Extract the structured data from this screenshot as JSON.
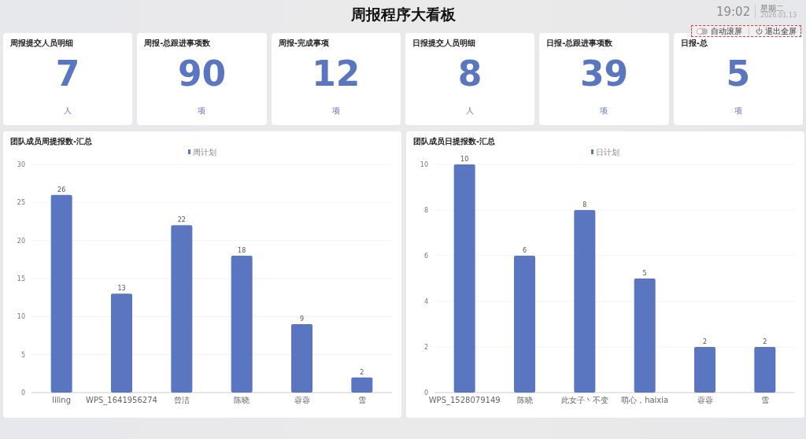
{
  "header": {
    "title": "周报程序大看板",
    "time": "19:02",
    "weekday": "星期二",
    "date": "2026.01.13"
  },
  "toolbar": {
    "auto_scroll": {
      "label": "自动滚屏",
      "on": false
    },
    "exit_label": "退出全屏"
  },
  "cards": [
    {
      "title": "周报提交人员明细",
      "value": "7",
      "unit": "人"
    },
    {
      "title": "周报-总跟进事项数",
      "value": "90",
      "unit": "项"
    },
    {
      "title": "周报-完成事项",
      "value": "12",
      "unit": "项"
    },
    {
      "title": "日报提交人员明细",
      "value": "8",
      "unit": "人"
    },
    {
      "title": "日报-总跟进事项数",
      "value": "39",
      "unit": "项"
    },
    {
      "title": "日报-总",
      "value": "5",
      "unit": "项"
    }
  ],
  "charts": [
    {
      "title": "团队成员周提报数-汇总",
      "chart_data": {
        "type": "bar",
        "categories": [
          "liling",
          "WPS_1641956274",
          "曾洁",
          "陈晓",
          "蓉蓉",
          "雪"
        ],
        "series": [
          {
            "name": "周计划",
            "color": "#5b76c1",
            "values": [
              26,
              13,
              22,
              18,
              9,
              2
            ]
          }
        ],
        "ylim": [
          0,
          30
        ],
        "yticks": [
          0,
          5,
          10,
          15,
          20,
          25,
          30
        ],
        "data_labels": true,
        "grid": true
      }
    },
    {
      "title": "团队成员日提报数-汇总",
      "chart_data": {
        "type": "bar",
        "categories": [
          "WPS_1528079149",
          "陈晓",
          "此女子丶不变",
          "萌心，haixia",
          "蓉蓉",
          "雪"
        ],
        "series": [
          {
            "name": "日计划",
            "color": "#5b76c1",
            "values": [
              10,
              6,
              8,
              5,
              2,
              2
            ]
          }
        ],
        "ylim": [
          0,
          10
        ],
        "yticks": [
          0,
          2,
          4,
          6,
          8,
          10
        ],
        "data_labels": true,
        "grid": true
      }
    }
  ]
}
